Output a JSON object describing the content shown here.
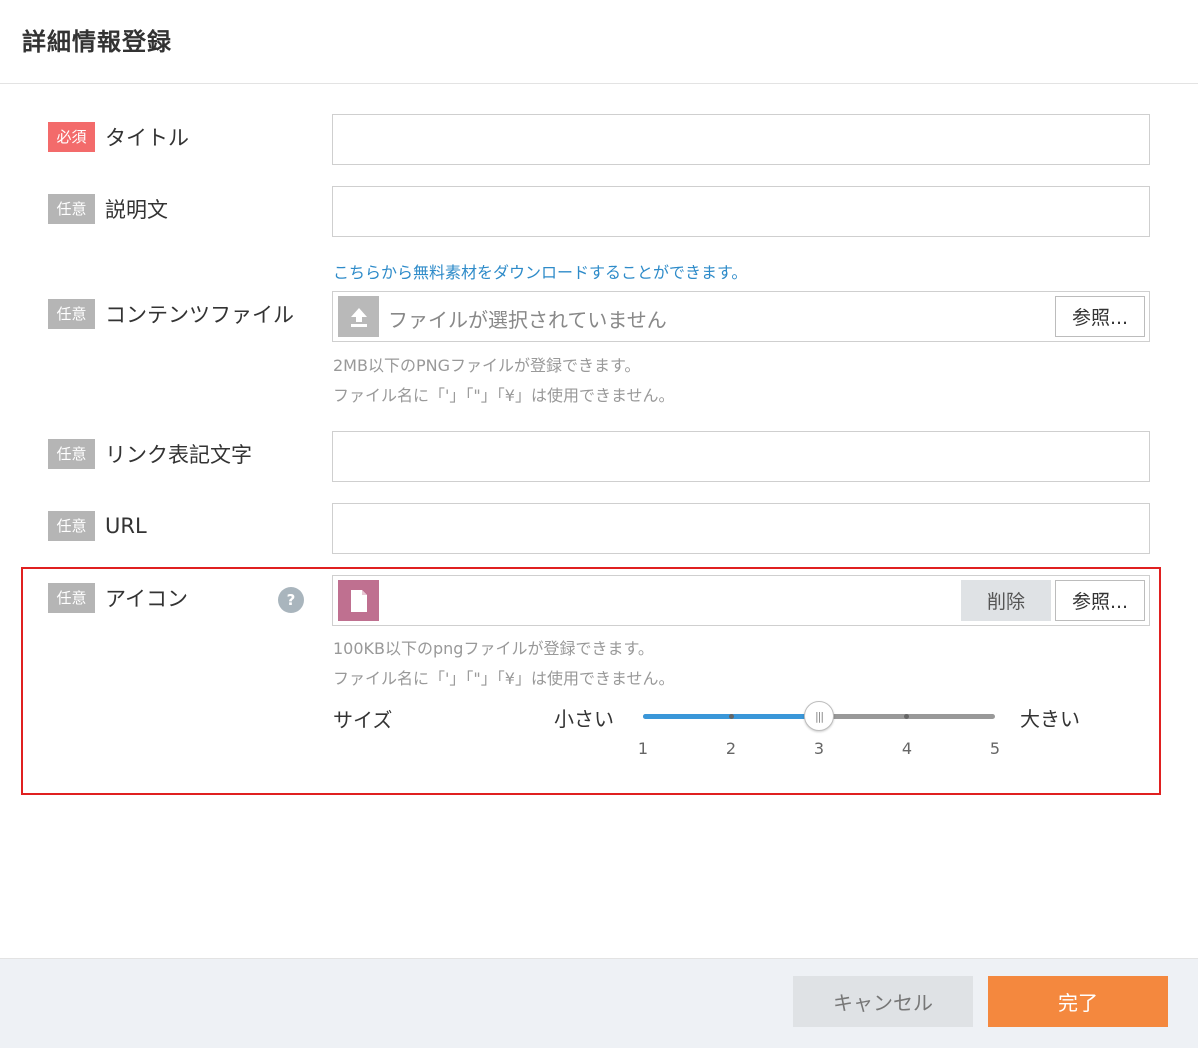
{
  "dialog": {
    "title": "詳細情報登録"
  },
  "badges": {
    "required": "必須",
    "optional": "任意"
  },
  "fields": {
    "title": {
      "label": "タイトル",
      "value": ""
    },
    "description": {
      "label": "説明文",
      "value": ""
    },
    "content_file": {
      "label": "コンテンツファイル",
      "download_link": "こちらから無料素材をダウンロードすることができます。",
      "placeholder": "ファイルが選択されていません",
      "browse_label": "参照...",
      "note1": "2MB以下のPNGファイルが登録できます。",
      "note2": "ファイル名に「'」「\"」「¥」は使用できません。",
      "icon": "upload-icon"
    },
    "link_text": {
      "label": "リンク表記文字",
      "value": ""
    },
    "url": {
      "label": "URL",
      "value": ""
    },
    "icon": {
      "label": "アイコン",
      "help": "?",
      "delete_label": "削除",
      "browse_label": "参照...",
      "note1": "100KB以下のpngファイルが登録できます。",
      "note2": "ファイル名に「'」「\"」「¥」は使用できません。",
      "thumb_icon": "file-icon",
      "thumb_color": "#bf7090"
    }
  },
  "size_slider": {
    "label": "サイズ",
    "min_label": "小さい",
    "max_label": "大きい",
    "ticks": [
      "1",
      "2",
      "3",
      "4",
      "5"
    ],
    "value": 3
  },
  "footer": {
    "cancel_label": "キャンセル",
    "done_label": "完了"
  },
  "colors": {
    "required_badge": "#f36b6b",
    "optional_badge": "#b5b5b5",
    "link": "#2e8bc9",
    "slider_fill": "#3a97d9",
    "done_button": "#f4883e",
    "highlight_border": "#e02020"
  }
}
